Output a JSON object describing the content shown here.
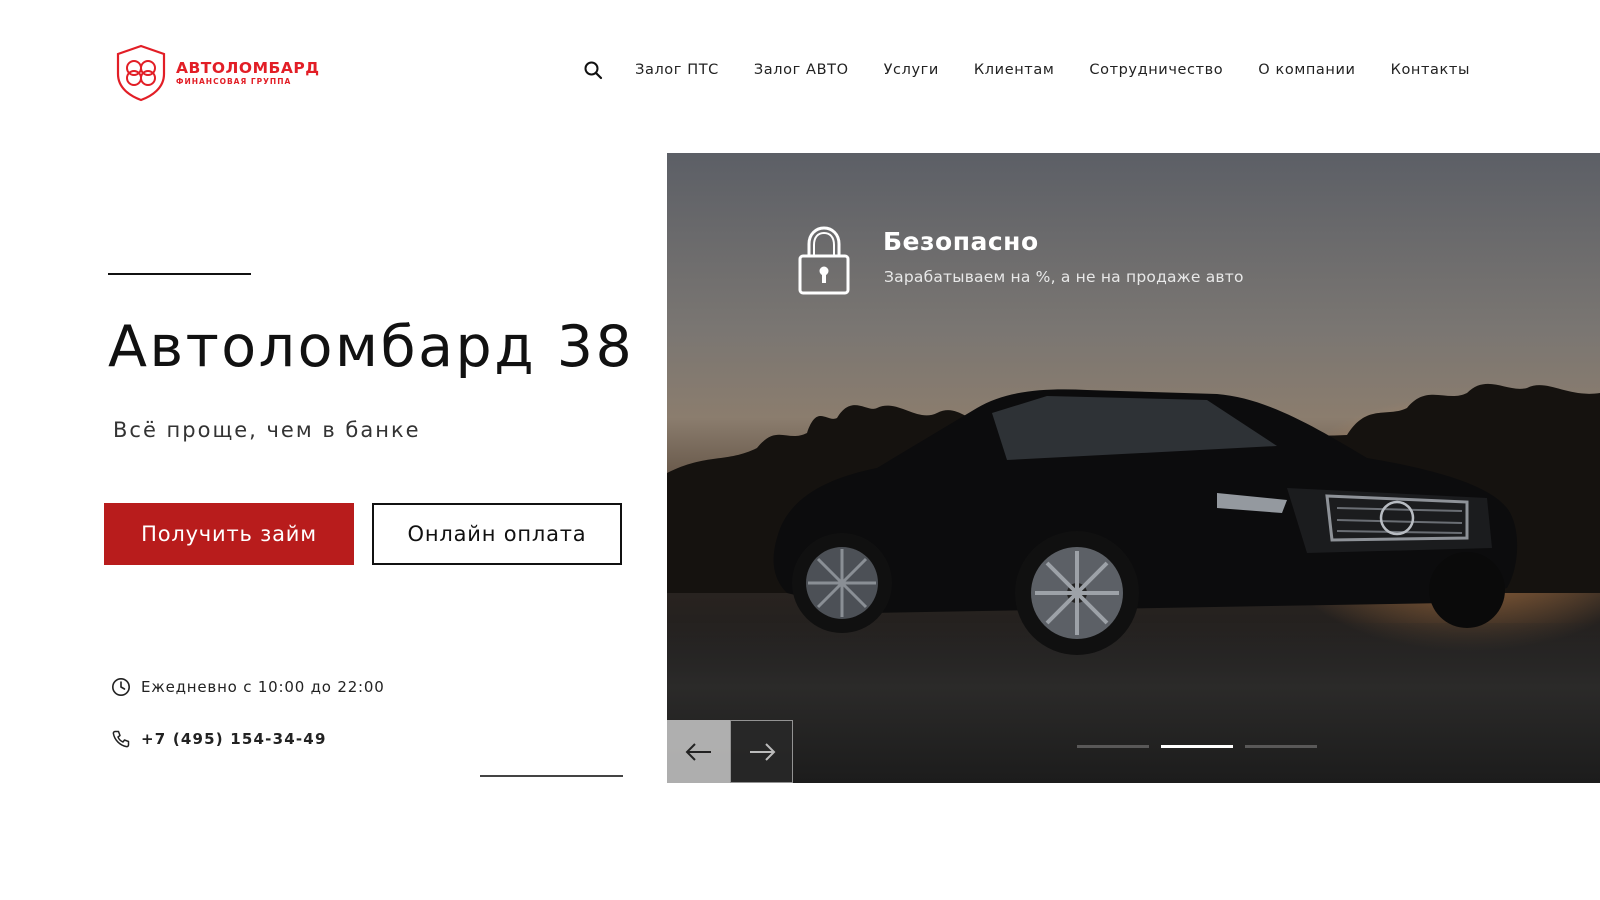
{
  "brand": {
    "title": "АВТОЛОМБАРД",
    "subtitle": "ФИНАНСОВАЯ ГРУППА",
    "accent_color": "#e21e26"
  },
  "nav": {
    "search_icon": "search-icon",
    "items": [
      {
        "label": "Залог ПТС"
      },
      {
        "label": "Залог АВТО"
      },
      {
        "label": "Услуги"
      },
      {
        "label": "Клиентам"
      },
      {
        "label": "Сотрудничество"
      },
      {
        "label": "О компании"
      },
      {
        "label": "Контакты"
      }
    ]
  },
  "hero": {
    "title": "Автоломбард 38",
    "subtitle": "Всё проще, чем в банке",
    "primary_button": "Получить займ",
    "secondary_button": "Онлайн оплата",
    "primary_color": "#b81c1c",
    "hours": "Ежедневно с 10:00 до 22:00",
    "phone": "+7 (495) 154-34-49"
  },
  "slider": {
    "slide": {
      "icon": "lock-icon",
      "heading": "Безопасно",
      "text": "Зарабатываем на %, а не на продаже авто"
    },
    "dots_count": 3,
    "active_dot": 1
  }
}
